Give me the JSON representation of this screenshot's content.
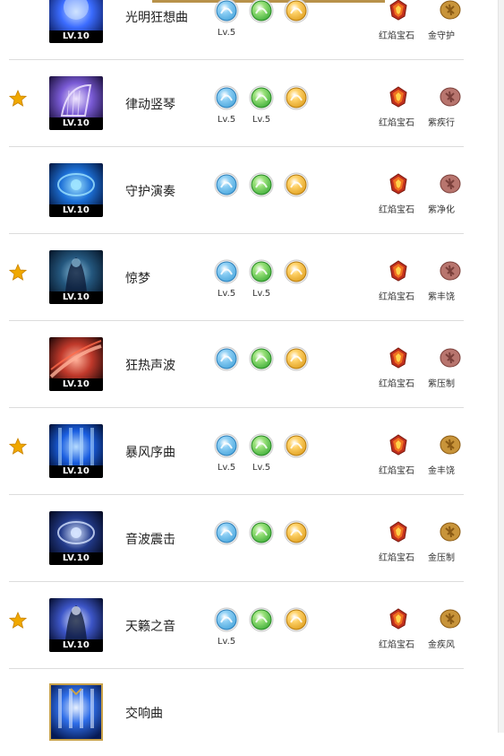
{
  "accent_colors": {
    "top_bar": "#b8924a",
    "star": "#e8a200",
    "divider": "#dcdcdc"
  },
  "skills": [
    {
      "name": "光明狂想曲",
      "level": "LV.10",
      "starred": false,
      "art": "blue-burst",
      "runes": [
        {
          "icon": "blue-wave-rune-icon",
          "color": "blue",
          "lv": "Lv.5"
        },
        {
          "icon": "green-people-rune-icon",
          "color": "green",
          "lv": ""
        },
        {
          "icon": "gold-people-rune-icon",
          "color": "gold",
          "lv": ""
        }
      ],
      "gems": [
        {
          "icon": "red-gem-icon",
          "label": "红焰宝石"
        },
        {
          "icon": "gold-glyph-icon",
          "label": "金守护"
        }
      ]
    },
    {
      "name": "律动竖琴",
      "level": "LV.10",
      "starred": true,
      "art": "purple-harp",
      "runes": [
        {
          "icon": "blue-clock-rune-icon",
          "color": "blue",
          "lv": "Lv.5"
        },
        {
          "icon": "green-note-rune-icon",
          "color": "green",
          "lv": "Lv.5"
        },
        {
          "icon": "gold-people-rune-icon",
          "color": "gold",
          "lv": ""
        }
      ],
      "gems": [
        {
          "icon": "red-gem-icon",
          "label": "红焰宝石"
        },
        {
          "icon": "purple-glyph-icon",
          "label": "紫疾行"
        }
      ]
    },
    {
      "name": "守护演奏",
      "level": "LV.10",
      "starred": false,
      "art": "blue-ring",
      "runes": [
        {
          "icon": "blue-person-rune-icon",
          "color": "blue",
          "lv": ""
        },
        {
          "icon": "green-person-rune-icon",
          "color": "green",
          "lv": ""
        },
        {
          "icon": "gold-people-rune-icon",
          "color": "gold",
          "lv": ""
        }
      ],
      "gems": [
        {
          "icon": "red-gem-icon",
          "label": "红焰宝石"
        },
        {
          "icon": "purple-glyph-icon",
          "label": "紫净化"
        }
      ]
    },
    {
      "name": "惊梦",
      "level": "LV.10",
      "starred": true,
      "art": "dark-figure",
      "runes": [
        {
          "icon": "blue-wave-rune-icon",
          "color": "blue",
          "lv": "Lv.5"
        },
        {
          "icon": "green-note-rune-icon",
          "color": "green",
          "lv": "Lv.5"
        },
        {
          "icon": "gold-person-rune-icon",
          "color": "gold",
          "lv": ""
        }
      ],
      "gems": [
        {
          "icon": "red-gem-icon",
          "label": "红焰宝石"
        },
        {
          "icon": "purple-glyph-icon",
          "label": "紫丰饶"
        }
      ]
    },
    {
      "name": "狂热声波",
      "level": "LV.10",
      "starred": false,
      "art": "red-slash",
      "runes": [
        {
          "icon": "blue-spiral-rune-icon",
          "color": "blue",
          "lv": ""
        },
        {
          "icon": "green-arrow-rune-icon",
          "color": "green",
          "lv": ""
        },
        {
          "icon": "gold-cross-rune-icon",
          "color": "gold",
          "lv": ""
        }
      ],
      "gems": [
        {
          "icon": "red-gem-icon",
          "label": "红焰宝石"
        },
        {
          "icon": "purple-glyph-icon",
          "label": "紫压制"
        }
      ]
    },
    {
      "name": "暴风序曲",
      "level": "LV.10",
      "starred": true,
      "art": "blue-pillars",
      "runes": [
        {
          "icon": "blue-wave-rune-icon",
          "color": "blue",
          "lv": "Lv.5"
        },
        {
          "icon": "green-note-rune-icon",
          "color": "green",
          "lv": "Lv.5"
        },
        {
          "icon": "gold-burst-rune-icon",
          "color": "gold",
          "lv": ""
        }
      ],
      "gems": [
        {
          "icon": "red-gem-icon",
          "label": "红焰宝石"
        },
        {
          "icon": "gold-glyph-icon",
          "label": "金丰饶"
        }
      ]
    },
    {
      "name": "音波震击",
      "level": "LV.10",
      "starred": false,
      "art": "dark-orb",
      "runes": [
        {
          "icon": "blue-person-rune-icon",
          "color": "blue",
          "lv": ""
        },
        {
          "icon": "green-burst-rune-icon",
          "color": "green",
          "lv": ""
        },
        {
          "icon": "gold-eye-rune-icon",
          "color": "gold",
          "lv": ""
        }
      ],
      "gems": [
        {
          "icon": "red-gem-icon",
          "label": "红焰宝石"
        },
        {
          "icon": "gold-glyph-icon",
          "label": "金压制"
        }
      ]
    },
    {
      "name": "天籁之音",
      "level": "LV.10",
      "starred": true,
      "art": "singer",
      "runes": [
        {
          "icon": "blue-wave-rune-icon",
          "color": "blue",
          "lv": "Lv.5"
        },
        {
          "icon": "green-people-rune-icon",
          "color": "green",
          "lv": ""
        },
        {
          "icon": "gold-spiral-rune-icon",
          "color": "gold",
          "lv": ""
        }
      ],
      "gems": [
        {
          "icon": "red-gem-icon",
          "label": "红焰宝石"
        },
        {
          "icon": "gold-glyph-icon",
          "label": "金疾风"
        }
      ]
    },
    {
      "name": "交响曲",
      "level": "",
      "starred": false,
      "art": "ultimate",
      "runes": [],
      "gems": []
    }
  ]
}
